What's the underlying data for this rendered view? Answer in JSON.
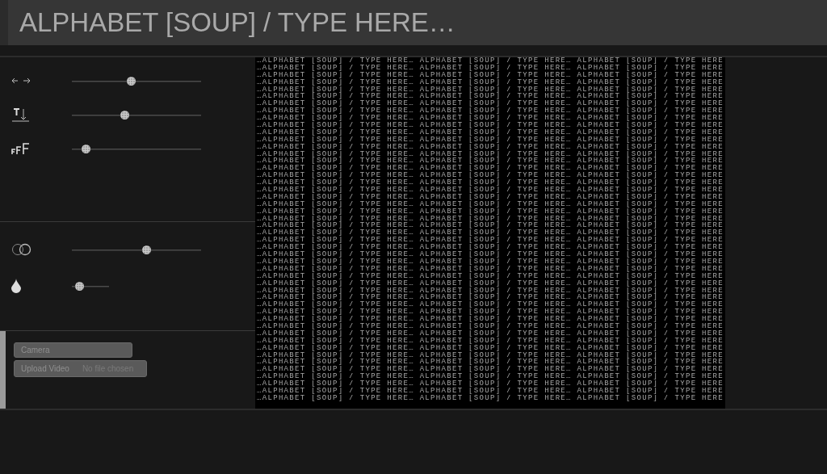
{
  "text_input": {
    "value": "ALPHABET [SOUP] / TYPE HERE…"
  },
  "slider_groups": [
    {
      "sliders": [
        {
          "kind": "full",
          "level": 0.45
        },
        {
          "kind": "full",
          "level": 0.4
        },
        {
          "kind": "full",
          "level": 0.08
        }
      ]
    },
    {
      "sliders": [
        {
          "kind": "full",
          "level": 0.58
        },
        {
          "kind": "short",
          "level": 0.12
        }
      ]
    }
  ],
  "source": {
    "camera_button": "Camera",
    "upload_button": "Upload Video",
    "file_status": "No file chosen"
  },
  "ascii_output": {
    "lines": [
      "…ALPHABET [SOUP] / TYPE HERE… ALPHABET [SOUP] / TYPE HERE… ALPHABET [SOUP] / TYPE HERE",
      "…ALPHABET [SOUP] / TYPE HERE… ALPHABET [SOUP] / TYPE HERE… ALPHABET [SOUP] / TYPE HERE",
      "…ALPHABET [SOUP] / TYPE HERE… ALPHABET [SOUP] / TYPE HERE… ALPHABET [SOUP] / TYPE HERE",
      "…ALPHABET [SOUP] / TYPE HERE… ALPHABET [SOUP] / TYPE HERE… ALPHABET [SOUP] / TYPE HERE",
      "…ALPHABET [SOUP] / TYPE HERE… ALPHABET [SOUP] / TYPE HERE… ALPHABET [SOUP] / TYPE HERE",
      "…ALPHABET [SOUP] / TYPE HERE… ALPHABET [SOUP] / TYPE HERE… ALPHABET [SOUP] / TYPE HERE",
      "…ALPHABET [SOUP] / TYPE HERE… ALPHABET [SOUP] / TYPE HERE… ALPHABET [SOUP] / TYPE HERE",
      "…ALPHABET [SOUP] / TYPE HERE… ALPHABET [SOUP] / TYPE HERE… ALPHABET [SOUP] / TYPE HERE",
      "…ALPHABET [SOUP] / TYPE HERE… ALPHABET [SOUP] / TYPE HERE… ALPHABET [SOUP] / TYPE HERE",
      "…ALPHABET [SOUP] / TYPE HERE… ALPHABET [SOUP] / TYPE HERE… ALPHABET [SOUP] / TYPE HERE",
      "…ALPHABET [SOUP] / TYPE HERE… ALPHABET [SOUP] / TYPE HERE… ALPHABET [SOUP] / TYPE HERE",
      "…ALPHABET [SOUP] / TYPE HERE… ALPHABET [SOUP] / TYPE HERE… ALPHABET [SOUP] / TYPE HERE",
      "…ALPHABET [SOUP] / TYPE HERE… ALPHABET [SOUP] / TYPE HERE… ALPHABET [SOUP] / TYPE HERE",
      "…ALPHABET [SOUP] / TYPE HERE… ALPHABET [SOUP] / TYPE HERE… ALPHABET [SOUP] / TYPE HERE",
      "…ALPHABET [SOUP] / TYPE HERE… ALPHABET [SOUP] / TYPE HERE… ALPHABET [SOUP] / TYPE HERE",
      "…ALPHABET [SOUP] / TYPE HERE… ALPHABET [SOUP] / TYPE HERE… ALPHABET [SOUP] / TYPE HERE",
      "…ALPHABET [SOUP] / TYPE HERE… ALPHABET [SOUP] / TYPE HERE… ALPHABET [SOUP] / TYPE HERE",
      "…ALPHABET [SOUP] / TYPE HERE… ALPHABET [SOUP] / TYPE HERE… ALPHABET [SOUP] / TYPE HERE",
      "…ALPHABET [SOUP] / TYPE HERE… ALPHABET [SOUP] / TYPE HERE… ALPHABET [SOUP] / TYPE HERE",
      "…ALPHABET [SOUP] / TYPE HERE… ALPHABET [SOUP] / TYPE HERE… ALPHABET [SOUP] / TYPE HERE",
      "…ALPHABET [SOUP] / TYPE HERE… ALPHABET [SOUP] / TYPE HERE… ALPHABET [SOUP] / TYPE HERE",
      "…ALPHABET [SOUP] / TYPE HERE… ALPHABET [SOUP] / TYPE HERE… ALPHABET [SOUP] / TYPE HERE",
      "…ALPHABET [SOUP] / TYPE HERE… ALPHABET [SOUP] / TYPE HERE… ALPHABET [SOUP] / TYPE HERE",
      "…ALPHABET [SOUP] / TYPE HERE… ALPHABET [SOUP] / TYPE HERE… ALPHABET [SOUP] / TYPE HERE",
      "…ALPHABET [SOUP] / TYPE HERE… ALPHABET [SOUP] / TYPE HERE… ALPHABET [SOUP] / TYPE HERE",
      "…ALPHABET [SOUP] / TYPE HERE… ALPHABET [SOUP] / TYPE HERE… ALPHABET [SOUP] / TYPE HERE",
      "…ALPHABET [SOUP] / TYPE HERE… ALPHABET [SOUP] / TYPE HERE… ALPHABET [SOUP] / TYPE HERE",
      "…ALPHABET [SOUP] / TYPE HERE… ALPHABET [SOUP] / TYPE HERE… ALPHABET [SOUP] / TYPE HERE",
      "…ALPHABET [SOUP] / TYPE HERE… ALPHABET [SOUP] / TYPE HERE… ALPHABET [SOUP] / TYPE HERE",
      "…ALPHABET [SOUP] / TYPE HERE… ALPHABET [SOUP] / TYPE HERE… ALPHABET [SOUP] / TYPE HERE",
      "…ALPHABET [SOUP] / TYPE HERE… ALPHABET [SOUP] / TYPE HERE… ALPHABET [SOUP] / TYPE HERE",
      "…ALPHABET [SOUP] / TYPE HERE… ALPHABET [SOUP] / TYPE HERE… ALPHABET [SOUP] / TYPE HERE",
      "…ALPHABET [SOUP] / TYPE HERE… ALPHABET [SOUP] / TYPE HERE… ALPHABET [SOUP] / TYPE HERE",
      "…ALPHABET [SOUP] / TYPE HERE… ALPHABET [SOUP] / TYPE HERE… ALPHABET [SOUP] / TYPE HERE",
      "…ALPHABET [SOUP] / TYPE HERE… ALPHABET [SOUP] / TYPE HERE… ALPHABET [SOUP] / TYPE HERE",
      "…ALPHABET [SOUP] / TYPE HERE… ALPHABET [SOUP] / TYPE HERE… ALPHABET [SOUP] / TYPE HERE",
      "…ALPHABET [SOUP] / TYPE HERE… ALPHABET [SOUP] / TYPE HERE… ALPHABET [SOUP] / TYPE HERE",
      "…ALPHABET [SOUP] / TYPE HERE… ALPHABET [SOUP] / TYPE HERE… ALPHABET [SOUP] / TYPE HERE",
      "…ALPHABET [SOUP] / TYPE HERE… ALPHABET [SOUP] / TYPE HERE… ALPHABET [SOUP] / TYPE HERE",
      "…ALPHABET [SOUP] / TYPE HERE… ALPHABET [SOUP] / TYPE HERE… ALPHABET [SOUP] / TYPE HERE",
      "…ALPHABET [SOUP] / TYPE HERE… ALPHABET [SOUP] / TYPE HERE… ALPHABET [SOUP] / TYPE HERE",
      "…ALPHABET [SOUP] / TYPE HERE… ALPHABET [SOUP] / TYPE HERE… ALPHABET [SOUP] / TYPE HERE",
      "…ALPHABET [SOUP] / TYPE HERE… ALPHABET [SOUP] / TYPE HERE… ALPHABET [SOUP] / TYPE HERE",
      "…ALPHABET [SOUP] / TYPE HERE… ALPHABET [SOUP] / TYPE HERE… ALPHABET [SOUP] / TYPE HERE",
      "…ALPHABET [SOUP] / TYPE HERE… ALPHABET [SOUP] / TYPE HERE… ALPHABET [SOUP] / TYPE HERE",
      "…ALPHABET [SOUP] / TYPE HERE… ALPHABET [SOUP] / TYPE HERE… ALPHABET [SOUP] / TYPE HERE",
      "…ALPHABET [SOUP] / TYPE HERE… ALPHABET [SOUP] / TYPE HERE… ALPHABET [SOUP] / TYPE HERE",
      "…ALPHABET [SOUP] / TYPE HERE… ALPHABET [SOUP] / TYPE HERE… ALPHABET [SOUP] / TYPE HERE"
    ]
  }
}
